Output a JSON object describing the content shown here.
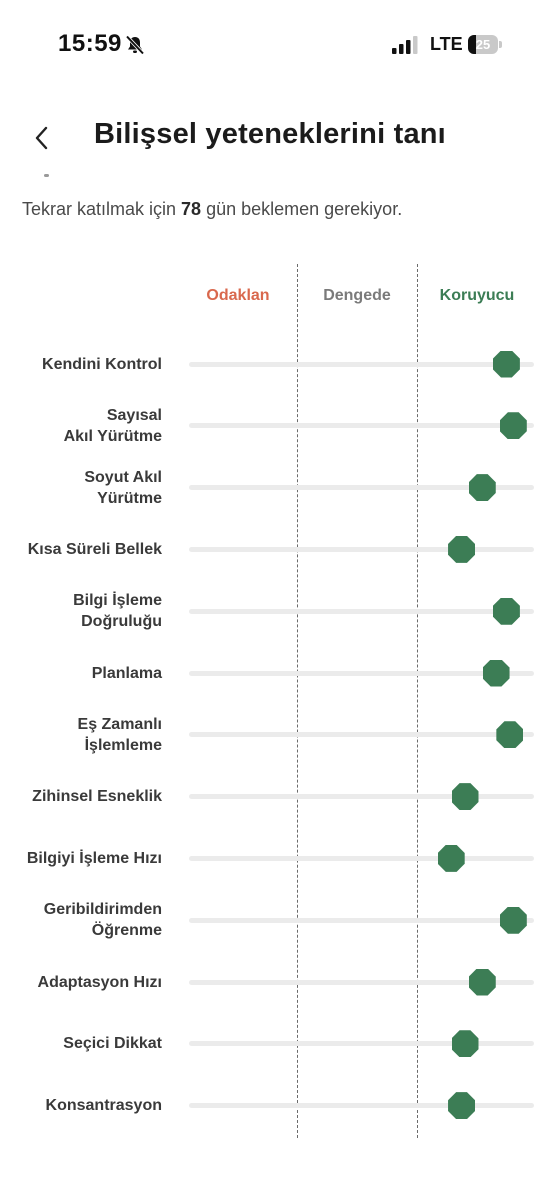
{
  "status_bar": {
    "time": "15:59",
    "network": "LTE",
    "battery": "25",
    "battery_level_percent": 25
  },
  "header": {
    "title": "Bilişsel yeteneklerini tanı",
    "back_icon": "chevron-left-icon"
  },
  "notice": {
    "prefix": "Tekrar katılmak için ",
    "days": "78",
    "suffix": " gün beklemen gerekiyor."
  },
  "chart_data": {
    "type": "scatter",
    "columns": [
      {
        "label": "Odaklan",
        "color": "#d9684d"
      },
      {
        "label": "Dengede",
        "color": "#7a7a7a"
      },
      {
        "label": "Koruyucu",
        "color": "#3c7d55"
      }
    ],
    "marker_color": "#3c7d55",
    "scale": [
      0,
      100
    ],
    "rows": [
      {
        "label": "Kendini Kontrol",
        "value": 92
      },
      {
        "label": "Sayısal\nAkıl Yürütme",
        "value": 94
      },
      {
        "label": "Soyut Akıl\nYürütme",
        "value": 85
      },
      {
        "label": "Kısa Süreli Bellek",
        "value": 79
      },
      {
        "label": "Bilgi İşleme\nDoğruluğu",
        "value": 92
      },
      {
        "label": "Planlama",
        "value": 89
      },
      {
        "label": "Eş Zamanlı\nİşlemleme",
        "value": 93
      },
      {
        "label": "Zihinsel Esneklik",
        "value": 80
      },
      {
        "label": "Bilgiyi İşleme Hızı",
        "value": 76
      },
      {
        "label": "Geribildirimden\nÖğrenme",
        "value": 94
      },
      {
        "label": "Adaptasyon Hızı",
        "value": 85
      },
      {
        "label": "Seçici Dikkat",
        "value": 80
      },
      {
        "label": "Konsantrasyon",
        "value": 79
      }
    ]
  }
}
